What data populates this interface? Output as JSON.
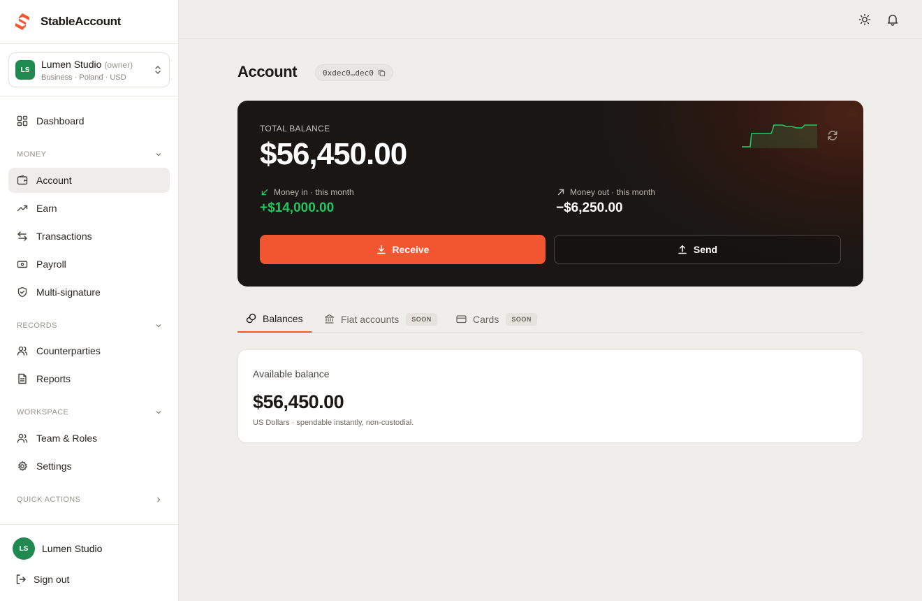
{
  "brand": {
    "name": "StableAccount",
    "accent": "#f25630"
  },
  "org": {
    "initials": "LS",
    "name": "Lumen Studio",
    "role": "(owner)",
    "meta": "Business · Poland · USD"
  },
  "nav": {
    "dashboard": "Dashboard",
    "money_section": "MONEY",
    "account": "Account",
    "earn": "Earn",
    "transactions": "Transactions",
    "payroll": "Payroll",
    "multisig": "Multi-signature",
    "records_section": "RECORDS",
    "counterparties": "Counterparties",
    "reports": "Reports",
    "workspace_section": "WORKSPACE",
    "team": "Team & Roles",
    "settings": "Settings",
    "quick_section": "QUICK ACTIONS"
  },
  "footer": {
    "initials": "LS",
    "name": "Lumen Studio",
    "signout": "Sign out"
  },
  "header": {
    "title": "Account",
    "address": "0xdec0…dec0"
  },
  "balance": {
    "label": "TOTAL BALANCE",
    "value": "$56,450.00",
    "in_label": "Money in · this month",
    "in_value": "+$14,000.00",
    "out_label": "Money out · this month",
    "out_value": "−$6,250.00",
    "receive": "Receive",
    "send": "Send",
    "positive_color": "#22c55e"
  },
  "tabs": [
    {
      "label": "Balances"
    },
    {
      "label": "Fiat accounts",
      "badge": "SOON"
    },
    {
      "label": "Cards",
      "badge": "SOON"
    }
  ],
  "available": {
    "label": "Available balance",
    "value": "$56,450.00",
    "sub": "US Dollars · spendable instantly, non-custodial."
  }
}
